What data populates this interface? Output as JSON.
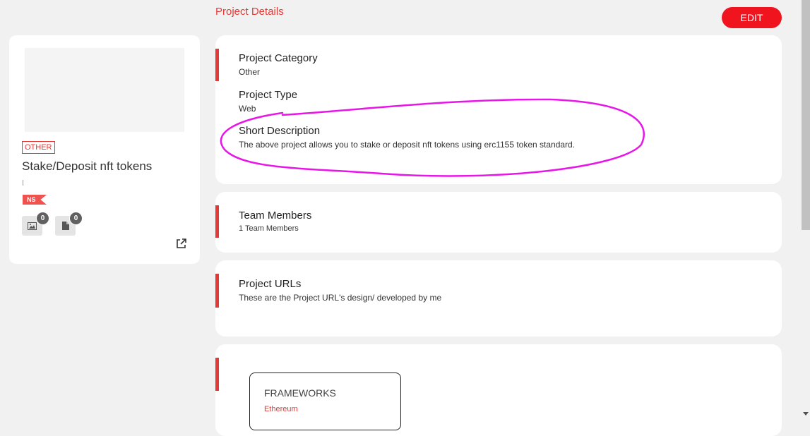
{
  "left_card": {
    "category_badge": "OTHER",
    "title": "Stake/Deposit nft tokens",
    "flag": "NS",
    "images_count": "0",
    "files_count": "0"
  },
  "header": {
    "section_title": "Project Details",
    "edit_label": "EDIT"
  },
  "details": {
    "category_label": "Project Category",
    "category_value": "Other",
    "type_label": "Project Type",
    "type_value": "Web",
    "desc_label": "Short Description",
    "desc_value": "The above project allows you to stake or deposit nft tokens using erc1155 token standard."
  },
  "team": {
    "label": "Team Members",
    "value": "1 Team Members"
  },
  "urls": {
    "label": "Project URLs",
    "value": "These are the Project URL's design/ developed by me"
  },
  "frameworks": {
    "title": "FRAMEWORKS",
    "items": [
      "Ethereum"
    ]
  },
  "colors": {
    "accent": "#e53935",
    "edit_button": "#f0141e",
    "annotation": "#e815e8"
  }
}
